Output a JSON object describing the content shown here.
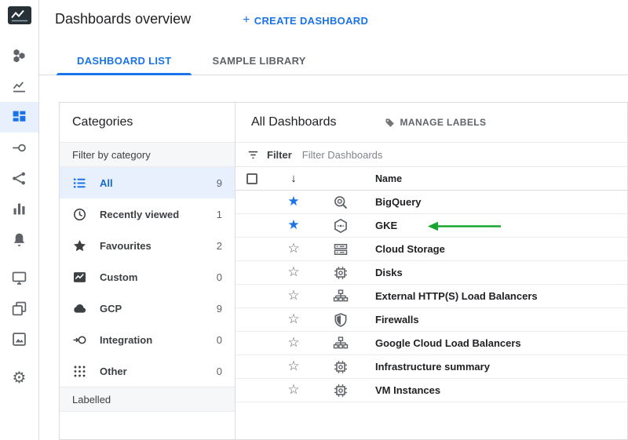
{
  "header": {
    "title": "Dashboards overview",
    "create_button_plus": "+",
    "create_button_label": "CREATE DASHBOARD"
  },
  "tabs": {
    "dashboard_list": "DASHBOARD LIST",
    "sample_library": "SAMPLE LIBRARY",
    "active": "DASHBOARD LIST"
  },
  "categories": {
    "title": "Categories",
    "filter_header": "Filter by category",
    "labelled_header": "Labelled",
    "items": [
      {
        "label": "All",
        "count": "9",
        "icon": "list",
        "selected": true
      },
      {
        "label": "Recently viewed",
        "count": "1",
        "icon": "clock",
        "selected": false
      },
      {
        "label": "Favourites",
        "count": "2",
        "icon": "star",
        "selected": false
      },
      {
        "label": "Custom",
        "count": "0",
        "icon": "custom-dashboard",
        "selected": false
      },
      {
        "label": "GCP",
        "count": "9",
        "icon": "cloud",
        "selected": false
      },
      {
        "label": "Integration",
        "count": "0",
        "icon": "integration",
        "selected": false
      },
      {
        "label": "Other",
        "count": "0",
        "icon": "dots-grid",
        "selected": false
      }
    ]
  },
  "dashboards": {
    "title": "All Dashboards",
    "manage_labels_label": "MANAGE LABELS",
    "filter_label": "Filter",
    "filter_placeholder": "Filter Dashboards",
    "name_column": "Name",
    "sort_indicator": "↓",
    "rows": [
      {
        "name": "BigQuery",
        "starred": true,
        "icon": "bigquery"
      },
      {
        "name": "GKE",
        "starred": true,
        "icon": "gke"
      },
      {
        "name": "Cloud Storage",
        "starred": false,
        "icon": "storage"
      },
      {
        "name": "Disks",
        "starred": false,
        "icon": "chip"
      },
      {
        "name": "External HTTP(S) Load Balancers",
        "starred": false,
        "icon": "loadbalancer"
      },
      {
        "name": "Firewalls",
        "starred": false,
        "icon": "shield"
      },
      {
        "name": "Google Cloud Load Balancers",
        "starred": false,
        "icon": "loadbalancer"
      },
      {
        "name": "Infrastructure summary",
        "starred": false,
        "icon": "chip"
      },
      {
        "name": "VM Instances",
        "starred": false,
        "icon": "chip"
      }
    ]
  },
  "annotation": {
    "type": "arrow-left",
    "color": "#18A52E",
    "points_to": "GKE"
  },
  "colors": {
    "accent": "#1a73e8",
    "text_primary": "#202124",
    "text_secondary": "#5f6368",
    "border": "#dadce0",
    "selected_bg": "#e8f0fe"
  }
}
